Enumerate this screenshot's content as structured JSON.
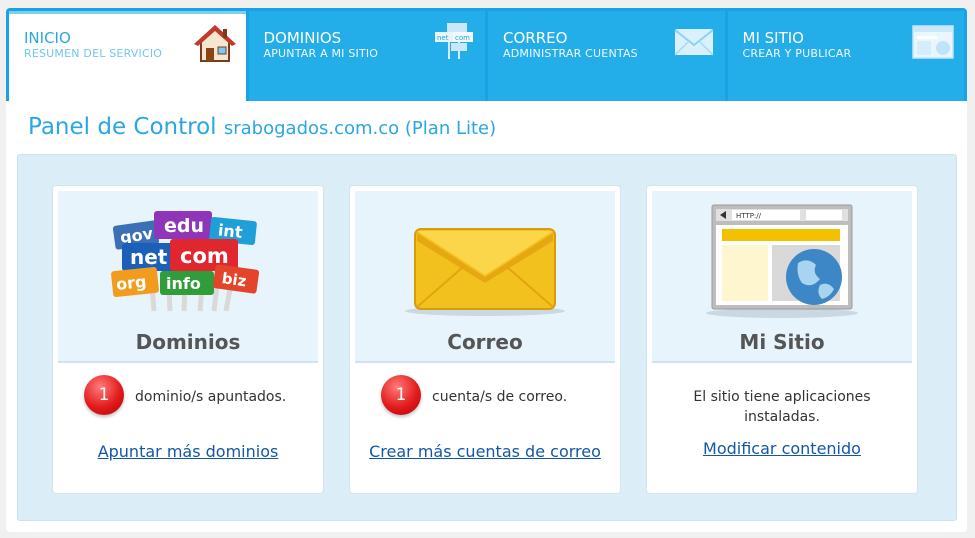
{
  "tabs": [
    {
      "title": "INICIO",
      "subtitle": "RESUMEN DEL SERVICIO",
      "icon": "house-icon",
      "active": true
    },
    {
      "title": "DOMINIOS",
      "subtitle": "APUNTAR A MI SITIO",
      "icon": "domain-signs-icon",
      "active": false
    },
    {
      "title": "CORREO",
      "subtitle": "ADMINISTRAR CUENTAS",
      "icon": "envelope-icon",
      "active": false
    },
    {
      "title": "MI SITIO",
      "subtitle": "CREAR Y PUBLICAR",
      "icon": "website-icon",
      "active": false
    }
  ],
  "panel": {
    "title": "Panel de Control",
    "domain": "srabogados.com.co (Plan Lite)"
  },
  "cards": {
    "dominios": {
      "name": "Dominios",
      "count": "1",
      "text": "dominio/s apuntados.",
      "link": "Apuntar más dominios",
      "signs": [
        "gov",
        "edu",
        "int",
        "net",
        "com",
        "org",
        "info",
        "biz"
      ]
    },
    "correo": {
      "name": "Correo",
      "count": "1",
      "text": "cuenta/s de correo.",
      "link": "Crear más cuentas de correo"
    },
    "sitio": {
      "name": "Mi Sitio",
      "text_line1": "El sitio tiene aplicaciones",
      "text_line2": "instaladas.",
      "link": "Modificar contenido",
      "browser_url": "HTTP://"
    }
  },
  "colors": {
    "accent": "#1aa3e4",
    "tab": "#23ade9",
    "title": "#2aa7e2",
    "area": "#dbedf7",
    "link": "#1257a8",
    "badge": "#e21c1c"
  }
}
